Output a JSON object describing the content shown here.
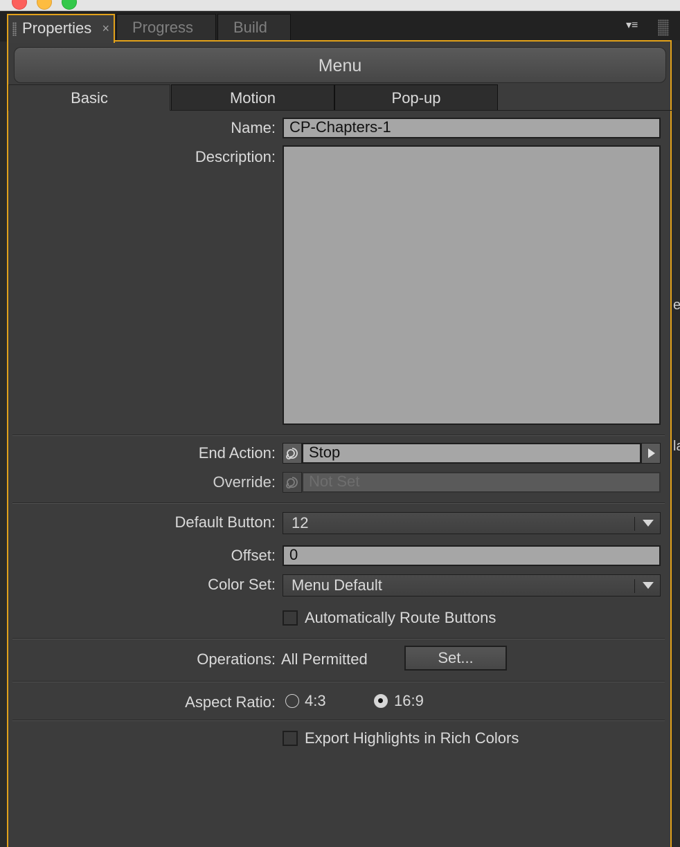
{
  "tabs": [
    {
      "label": "Properties"
    },
    {
      "label": "Progress"
    },
    {
      "label": "Build"
    }
  ],
  "tab_close": "×",
  "panel_menu_glyph": "▾≡",
  "header": {
    "title": "Menu"
  },
  "subtabs": [
    {
      "label": "Basic"
    },
    {
      "label": "Motion"
    },
    {
      "label": "Pop-up"
    }
  ],
  "fields": {
    "name_label": "Name:",
    "name_value": "CP-Chapters-1",
    "description_label": "Description:",
    "end_action_label": "End Action:",
    "end_action_value": "Stop",
    "override_label": "Override:",
    "override_value": "Not Set",
    "default_button_label": "Default Button:",
    "default_button_value": "12",
    "offset_label": "Offset:",
    "offset_value": "0",
    "color_set_label": "Color Set:",
    "color_set_value": "Menu Default",
    "auto_route_label": "Automatically Route Buttons",
    "operations_label": "Operations:",
    "operations_value": "All Permitted",
    "set_button": "Set...",
    "aspect_ratio_label": "Aspect Ratio:",
    "aspect_4_3": "4:3",
    "aspect_16_9": "16:9",
    "aspect_selected": "16:9",
    "export_highlights_label": "Export Highlights in Rich Colors"
  },
  "right_strip": {
    "text1": "er",
    "text2": "la"
  },
  "colors": {
    "accent": "#e3a21a",
    "panel_bg": "#3c3c3c",
    "field_bg": "#a6a6a6"
  }
}
